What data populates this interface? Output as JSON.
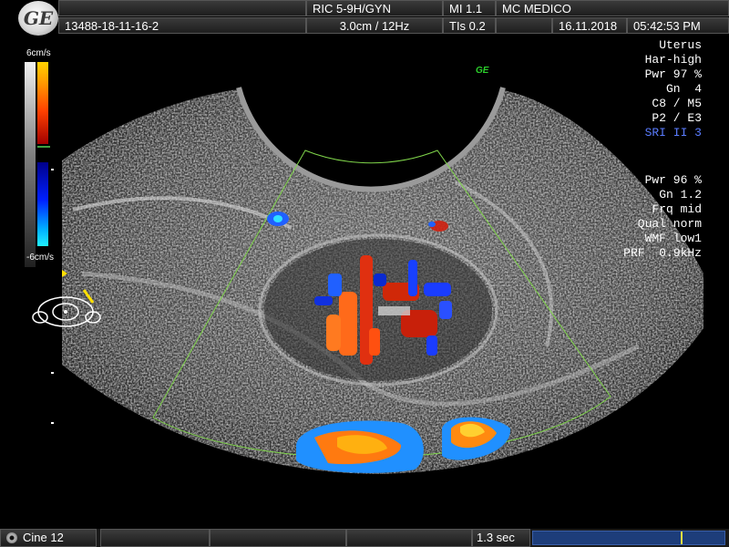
{
  "header": {
    "logo": "GE",
    "patient_id": "13488-18-11-16-2",
    "probe": "RIC 5-9H/GYN",
    "depth_freq": "3.0cm / 12Hz",
    "mi": "MI  1.1",
    "tis": "TIs  0.2",
    "clinic": "MC MEDICO",
    "date": "16.11.2018",
    "time": "05:42:53 PM"
  },
  "colorbar": {
    "top_label": "6cm/s",
    "bottom_label": "-6cm/s",
    "colors": {
      "warm": "#ff4000",
      "cool": "#0020ff",
      "baseline": "#40a040"
    }
  },
  "params_bmode": [
    "Uterus",
    "Har-high",
    "Pwr 97 %",
    "Gn  4",
    "C8 / M5",
    "P2 / E3",
    "SRI II 3"
  ],
  "params_color": [
    "Pwr 96 %",
    "Gn 1.2",
    "Frq mid",
    "Qual norm",
    "WMF low1",
    "PRF  0.9kHz"
  ],
  "ge_mark": "GE",
  "footer": {
    "cine": "Cine 12",
    "duration": "1.3 sec",
    "cine_position": 0.78
  },
  "icons": {
    "probe": "probe-orientation-icon",
    "disc": "cine-disc-icon"
  },
  "accent": "#7fd44a"
}
